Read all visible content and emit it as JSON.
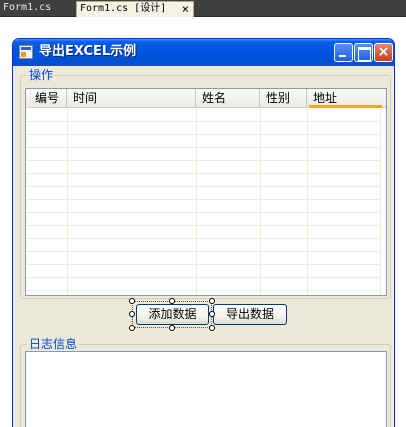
{
  "ide": {
    "tabs": [
      {
        "label": "Form1.cs"
      },
      {
        "label": "Form1.cs [设计]"
      }
    ],
    "close_glyph": "×"
  },
  "form": {
    "title": "导出EXCEL示例",
    "icon": "app-form-icon",
    "caption_buttons": {
      "minimize": "minimize-icon",
      "maximize": "maximize-icon",
      "close": "×"
    },
    "colors": {
      "title_bar": "#0054e3",
      "client": "#ece9d8",
      "group_label": "#0046d5",
      "sort_highlight": "#f5a623"
    }
  },
  "operations_group": {
    "label": "操作",
    "grid": {
      "columns": [
        "编号",
        "时间",
        "姓名",
        "性别",
        "地址"
      ],
      "rows": []
    },
    "buttons": {
      "add": "添加数据",
      "export": "导出数据"
    }
  },
  "log_group": {
    "label": "日志信息",
    "content": ""
  }
}
